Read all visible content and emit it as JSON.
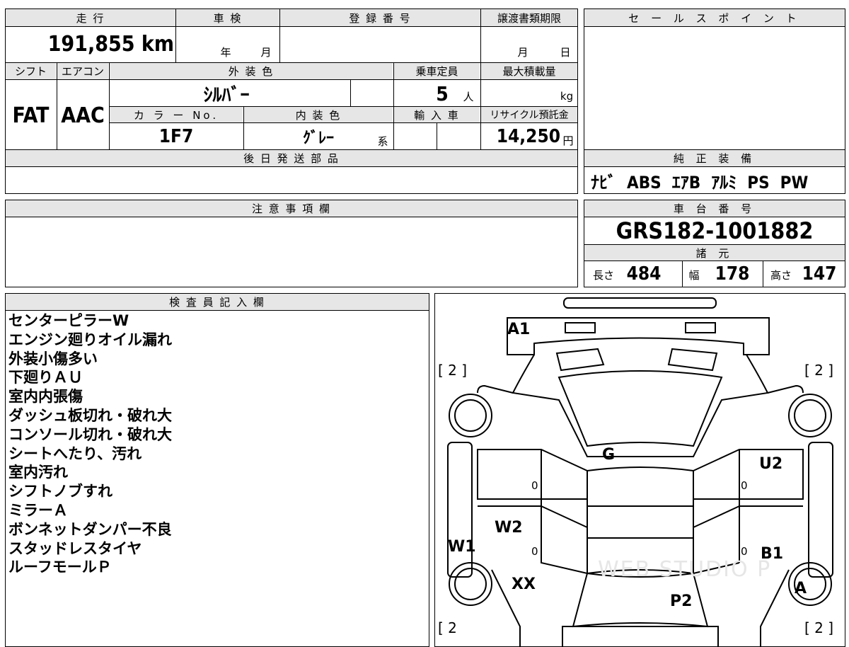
{
  "vehicle": {
    "mileage_label": "走 行",
    "mileage": "191,855 km",
    "shaken_label": "車 検",
    "shaken_year": "年",
    "shaken_month": "月",
    "reg_no_label": "登 録 番 号",
    "transfer_label": "譲渡書類期限",
    "transfer_month": "月",
    "transfer_day": "日",
    "shift_label": "シフト",
    "shift": "FAT",
    "aircon_label": "エアコン",
    "aircon": "AAC",
    "exterior_label": "外 装 色",
    "exterior": "ｼﾙﾊﾞｰ",
    "capacity_label": "乗車定員",
    "capacity": "5",
    "capacity_unit": "人",
    "maxload_label": "最大積載量",
    "maxload_unit": "kg",
    "color_no_label": "カ ラ ー No.",
    "color_no": "1F7",
    "interior_label": "内 装 色",
    "interior": "ｸﾞﾚｰ",
    "interior_suffix": "系",
    "import_label": "輸 入 車",
    "recycle_label": "リサイクル預託金",
    "recycle": "14,250",
    "recycle_unit": "円",
    "later_parts_label": "後 日 発 送 部 品",
    "notes_label": "注 意 事 項 欄"
  },
  "right": {
    "sales_point_label": "セ ー ル ス ポ イ ン ト",
    "equipment_label": "純 正 装 備",
    "equipment": "ﾅﾋﾞ  ABS  ｴｱB  ｱﾙﾐ  PS  PW",
    "chassis_label": "車 台 番 号",
    "chassis": "GRS182-1001882",
    "specs_label": "諸 元",
    "length_label": "長さ",
    "length": "484",
    "width_label": "幅",
    "width": "178",
    "height_label": "高さ",
    "height": "147"
  },
  "inspector": {
    "label": "検 査 員 記 入 欄",
    "remarks": [
      "センターピラーW",
      "エンジン廻りオイル漏れ",
      "外装小傷多い",
      "下廻りＡＵ",
      "室内内張傷",
      "ダッシュ板切れ・破れ大",
      "コンソール切れ・破れ大",
      "シートへたり、汚れ",
      "室内汚れ",
      "シフトノブすれ",
      "ミラーＡ",
      "ボンネットダンパー不良",
      "スタッドレスタイヤ",
      "ルーフモールＰ"
    ]
  },
  "diagram": {
    "marks": {
      "a1": "A1",
      "g": "G",
      "u2": "U2",
      "w2": "W2",
      "w1": "W1",
      "b1": "B1",
      "xx": "XX",
      "p2": "P2",
      "a": "A"
    },
    "tread_tl": "[ 2 ]",
    "tread_tr": "[ 2 ]",
    "tread_bl": "[ 2",
    "tread_br": "[ 2 ]",
    "zero": "0",
    "watermark": "WEB STUDIO P"
  }
}
